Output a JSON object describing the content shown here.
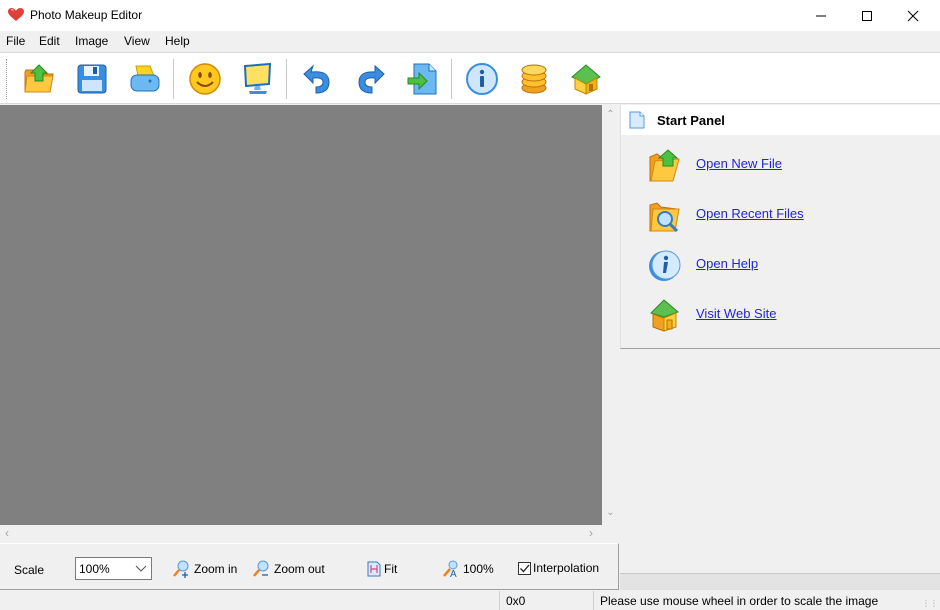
{
  "window": {
    "title": "Photo Makeup Editor",
    "app_icon": "heart-icon",
    "controls": {
      "minimize": "minimize",
      "maximize": "maximize",
      "close": "close"
    }
  },
  "menu": {
    "items": [
      {
        "label": "File"
      },
      {
        "label": "Edit"
      },
      {
        "label": "Image"
      },
      {
        "label": "View"
      },
      {
        "label": "Help"
      }
    ]
  },
  "toolbar": {
    "buttons": [
      {
        "name": "open",
        "icon": "folder-open-icon"
      },
      {
        "name": "save",
        "icon": "floppy-disk-icon"
      },
      {
        "name": "print",
        "icon": "printer-icon"
      },
      {
        "name": "makeup",
        "icon": "smiley-icon"
      },
      {
        "name": "slideshow",
        "icon": "monitor-icon"
      },
      {
        "name": "undo",
        "icon": "undo-arrow-icon"
      },
      {
        "name": "redo",
        "icon": "redo-arrow-icon"
      },
      {
        "name": "export",
        "icon": "document-export-icon"
      },
      {
        "name": "about",
        "icon": "info-icon"
      },
      {
        "name": "buy",
        "icon": "coins-icon"
      },
      {
        "name": "home",
        "icon": "home-icon"
      }
    ]
  },
  "start_panel": {
    "title": "Start Panel",
    "links": [
      {
        "label": "Open New File",
        "icon": "folder-open-icon"
      },
      {
        "label": "Open Recent Files",
        "icon": "folder-search-icon"
      },
      {
        "label": "Open Help",
        "icon": "info-icon"
      },
      {
        "label": "Visit Web Site",
        "icon": "home-icon"
      }
    ]
  },
  "scale_bar": {
    "scale_label": "Scale",
    "scale_value": "100%",
    "zoom_in_label": "Zoom in",
    "zoom_out_label": "Zoom out",
    "fit_label": "Fit",
    "actual_size_label": "100%",
    "interpolation_label": "Interpolation",
    "interpolation_checked": true
  },
  "status": {
    "dimensions": "0x0",
    "hint": "Please use mouse wheel in order to scale the image"
  }
}
